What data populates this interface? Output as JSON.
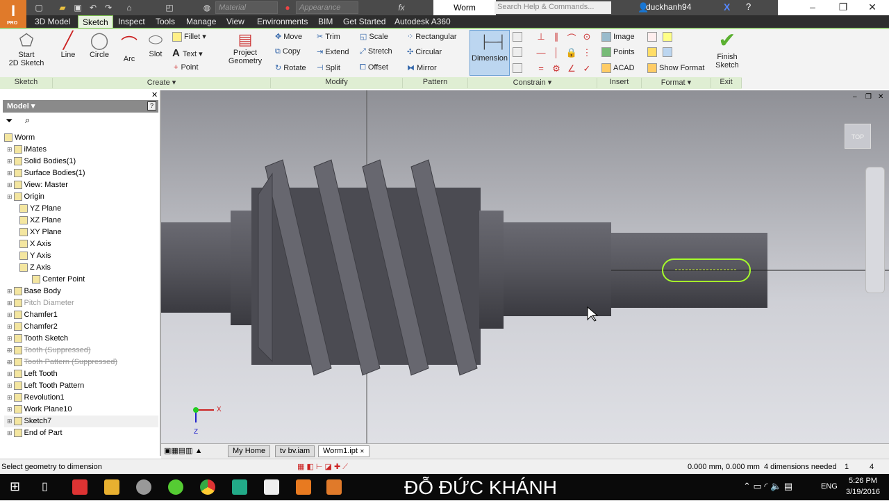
{
  "app": {
    "logo": "I",
    "edition": "PRO",
    "document_title": "Worm",
    "material_placeholder": "Material",
    "appearance_placeholder": "Appearance",
    "search_placeholder": "Search Help & Commands...",
    "user": "duckhanh94"
  },
  "tabs": [
    "3D Model",
    "Sketch",
    "Inspect",
    "Tools",
    "Manage",
    "View",
    "Environments",
    "BIM",
    "Get Started",
    "Autodesk A360"
  ],
  "active_tab": "Sketch",
  "ribbon": {
    "sketch": {
      "start": "Start",
      "start2": "2D Sketch",
      "label": "Sketch"
    },
    "create": {
      "line": "Line",
      "circle": "Circle",
      "arc": "Arc",
      "slot": "Slot",
      "fillet": "Fillet",
      "text": "Text",
      "point": "Point",
      "project1": "Project",
      "project2": "Geometry",
      "label": "Create ▾"
    },
    "modify": {
      "move": "Move",
      "copy": "Copy",
      "rotate": "Rotate",
      "trim": "Trim",
      "extend": "Extend",
      "split": "Split",
      "scale": "Scale",
      "stretch": "Stretch",
      "offset": "Offset",
      "label": "Modify"
    },
    "pattern": {
      "rectangular": "Rectangular",
      "circular": "Circular",
      "mirror": "Mirror",
      "label": "Pattern"
    },
    "constrain": {
      "dimension": "Dimension",
      "label": "Constrain ▾"
    },
    "insert": {
      "image": "Image",
      "points": "Points",
      "acad": "ACAD",
      "label": "Insert"
    },
    "format": {
      "show_format": "Show Format",
      "label": "Format ▾"
    },
    "exit": {
      "finish1": "Finish",
      "finish2": "Sketch",
      "label": "Exit"
    }
  },
  "browser": {
    "title": "Model ▾",
    "items": [
      {
        "label": "Worm",
        "level": 0,
        "style": "normal"
      },
      {
        "label": "iMates",
        "level": 1,
        "style": "normal"
      },
      {
        "label": "Solid Bodies(1)",
        "level": 1,
        "style": "normal"
      },
      {
        "label": "Surface Bodies(1)",
        "level": 1,
        "style": "normal"
      },
      {
        "label": "View: Master",
        "level": 1,
        "style": "normal"
      },
      {
        "label": "Origin",
        "level": 1,
        "style": "normal"
      },
      {
        "label": "YZ Plane",
        "level": 2,
        "style": "normal"
      },
      {
        "label": "XZ Plane",
        "level": 2,
        "style": "normal"
      },
      {
        "label": "XY Plane",
        "level": 2,
        "style": "normal"
      },
      {
        "label": "X Axis",
        "level": 2,
        "style": "normal"
      },
      {
        "label": "Y Axis",
        "level": 2,
        "style": "normal"
      },
      {
        "label": "Z Axis",
        "level": 2,
        "style": "normal"
      },
      {
        "label": "Center Point",
        "level": 3,
        "style": "normal"
      },
      {
        "label": "Base Body",
        "level": 1,
        "style": "normal"
      },
      {
        "label": "Pitch Diameter",
        "level": 1,
        "style": "dim"
      },
      {
        "label": "Chamfer1",
        "level": 1,
        "style": "normal"
      },
      {
        "label": "Chamfer2",
        "level": 1,
        "style": "normal"
      },
      {
        "label": "Tooth Sketch",
        "level": 1,
        "style": "normal"
      },
      {
        "label": "Tooth (Suppressed)",
        "level": 1,
        "style": "strike"
      },
      {
        "label": "Tooth Pattern (Suppressed)",
        "level": 1,
        "style": "strike"
      },
      {
        "label": "Left Tooth",
        "level": 1,
        "style": "normal"
      },
      {
        "label": "Left Tooth Pattern",
        "level": 1,
        "style": "normal"
      },
      {
        "label": "Revolution1",
        "level": 1,
        "style": "normal"
      },
      {
        "label": "Work Plane10",
        "level": 1,
        "style": "normal"
      },
      {
        "label": "Sketch7",
        "level": 1,
        "style": "sel"
      },
      {
        "label": "End of Part",
        "level": 1,
        "style": "normal"
      }
    ]
  },
  "viewcube": "TOP",
  "axes": {
    "x": "X",
    "z": "Z"
  },
  "doc_tabs": [
    "My Home",
    "tv bv.iam",
    "Worm1.ipt"
  ],
  "status": {
    "message": "Select geometry to dimension",
    "coords": "0.000 mm, 0.000 mm",
    "needed": "4 dimensions needed",
    "n1": "1",
    "n2": "4"
  },
  "taskbar": {
    "caption": "ĐỖ ĐỨC KHÁNH",
    "lang": "ENG",
    "time": "5:26 PM",
    "date": "3/19/2016"
  },
  "colors": {
    "accent": "#7cc24f",
    "sketch_highlight": "#a6ff2a",
    "logo": "#e07a2a"
  }
}
